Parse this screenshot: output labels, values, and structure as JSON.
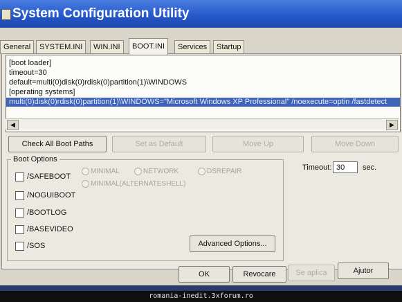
{
  "window": {
    "title": "System Configuration Utility"
  },
  "tabs": [
    {
      "label": "General"
    },
    {
      "label": "SYSTEM.INI"
    },
    {
      "label": "WIN.INI"
    },
    {
      "label": "BOOT.INI"
    },
    {
      "label": "Services"
    },
    {
      "label": "Startup"
    }
  ],
  "active_tab": "BOOT.INI",
  "boot_ini_lines": [
    "[boot loader]",
    "timeout=30",
    "default=multi(0)disk(0)rdisk(0)partition(1)\\WINDOWS",
    "[operating systems]",
    "multi(0)disk(0)rdisk(0)partition(1)\\WINDOWS=\"Microsoft Windows XP Professional\" /noexecute=optin /fastdetect"
  ],
  "path_buttons": {
    "check_all": "Check All Boot Paths",
    "set_default": "Set as Default",
    "move_up": "Move Up",
    "move_down": "Move Down"
  },
  "boot_options": {
    "title": "Boot Options",
    "checkboxes": [
      {
        "label": "/SAFEBOOT",
        "checked": false
      },
      {
        "label": "/NOGUIBOOT",
        "checked": false
      },
      {
        "label": "/BOOTLOG",
        "checked": false
      },
      {
        "label": "/BASEVIDEO",
        "checked": false
      },
      {
        "label": "/SOS",
        "checked": false
      }
    ],
    "radios": [
      {
        "label": "MINIMAL",
        "enabled": false
      },
      {
        "label": "NETWORK",
        "enabled": false
      },
      {
        "label": "DSREPAIR",
        "enabled": false
      },
      {
        "label": "MINIMAL(ALTERNATESHELL)",
        "enabled": false
      }
    ],
    "advanced_button": "Advanced Options..."
  },
  "timeout": {
    "label": "Timeout:",
    "value": "30",
    "unit": "sec."
  },
  "dialog_buttons": {
    "ok": "OK",
    "cancel": "Revocare",
    "apply": "Se aplica",
    "help": "Ajutor"
  },
  "watermark": "romania-inedit.3xforum.ro",
  "colors": {
    "titlebar": "#2356c8",
    "selection": "#3f63b8",
    "dialog_bg": "#eceae0",
    "disabled_text": "#b0aea4"
  }
}
